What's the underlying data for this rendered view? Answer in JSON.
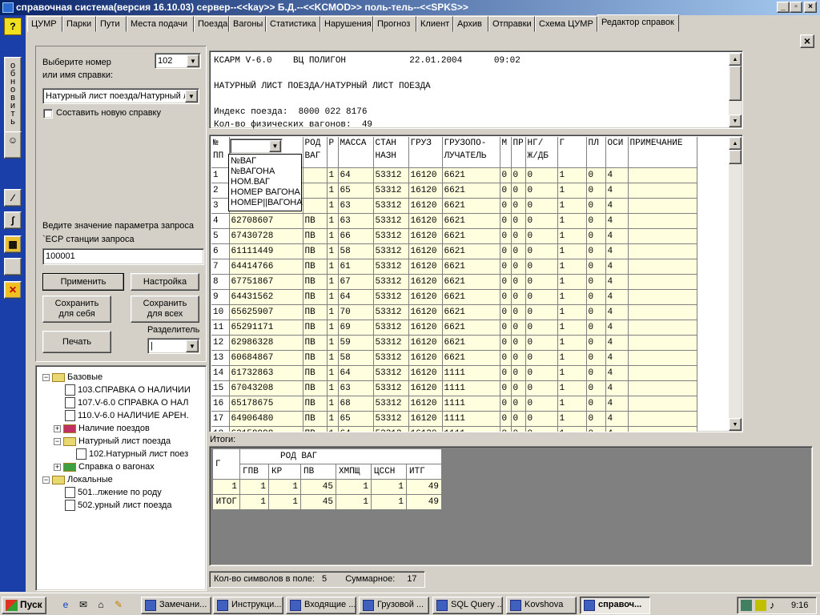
{
  "window": {
    "title": "справочная система(версия 16.10.03) сервер--<<kay>> Б.Д.--<<KCMOD>> поль-тель--<<SPKS>>",
    "min_label": "_",
    "max_label": "▫",
    "close_label": "×"
  },
  "toolbar": {
    "help_label": "?",
    "refresh_label": "обновить"
  },
  "tabs": [
    {
      "label": "ЦУМР"
    },
    {
      "label": "Парки"
    },
    {
      "label": "Пути"
    },
    {
      "label": "Места подачи"
    },
    {
      "label": "Поезда"
    },
    {
      "label": "Вагоны"
    },
    {
      "label": "Статистика"
    },
    {
      "label": "Нарушения"
    },
    {
      "label": "Прогноз"
    },
    {
      "label": "Клиент"
    },
    {
      "label": "Архив"
    },
    {
      "label": "Отправки"
    },
    {
      "label": "Схема ЦУМР"
    },
    {
      "label": "Редактор справок",
      "active": true
    }
  ],
  "close_panel_label": "×",
  "left": {
    "select_label_1": "Выберите номер",
    "select_label_2": "или имя справки:",
    "number_value": "102",
    "name_value": "Натурный лист поезда/Натурный л",
    "new_report_label": "Составить новую справку",
    "param_label": "Ведите значение параметра запроса",
    "param_name": "`ЕСР станции запроса",
    "param_value": "100001",
    "apply_label": "Применить",
    "settings_label": "Настройка",
    "save_self_1": "Сохранить",
    "save_self_2": "для себя",
    "save_all_1": "Сохранить",
    "save_all_2": "для всех",
    "separator_label": "Разделитель",
    "separator_value": "|",
    "print_label": "Печать"
  },
  "tree": [
    {
      "label": "Базовые",
      "type": "folder",
      "exp": "−",
      "level": 0
    },
    {
      "label": "103.СПРАВКА О НАЛИЧИИ",
      "type": "doc",
      "level": 2
    },
    {
      "label": "107.V-6.0  СПРАВКА О НАЛ",
      "type": "doc",
      "level": 2
    },
    {
      "label": "110.V-6.0  НАЛИЧИЕ АРЕН.",
      "type": "doc",
      "level": 2
    },
    {
      "label": "Наличие поездов",
      "type": "folder-color",
      "exp": "+",
      "level": 1
    },
    {
      "label": "Натурный лист поезда",
      "type": "folder",
      "exp": "−",
      "level": 1
    },
    {
      "label": "102.Натурный лист поез",
      "type": "doc",
      "level": 3
    },
    {
      "label": "Справка о вагонах",
      "type": "folder-green",
      "exp": "+",
      "level": 1
    },
    {
      "label": "Локальные",
      "type": "folder",
      "exp": "−",
      "level": 0
    },
    {
      "label": "501..лжение по роду",
      "type": "doc",
      "level": 2
    },
    {
      "label": "502.урный лист поезда",
      "type": "doc",
      "level": 2
    }
  ],
  "header_text": "КСАРМ V-6.0    ВЦ ПОЛИГОН            22.01.2004      09:02\n\nНАТУРНЫЙ ЛИСТ ПОЕЗДА/НАТУРНЫЙ ЛИСТ ПОЕЗДА\n\nИндекс поезда:  8000 022 8176\nКол-во физических вагонов:  49",
  "grid": {
    "headers": [
      "№\nПП",
      "",
      "РОД\nВАГ",
      "Р",
      "МАССА",
      "СТАН\nНАЗН",
      "ГРУЗ",
      "ГРУЗОПО-\nЛУЧАТЕЛЬ",
      "М",
      "ПР",
      "НГ/\nЖ/ДБ",
      "Г",
      "ПЛ",
      "ОСИ",
      "ПРИМЕЧАНИЕ"
    ],
    "rows": [
      [
        "1",
        "",
        "",
        "1",
        "64",
        "53312",
        "16120",
        "6621",
        "0",
        "0",
        "0",
        "1",
        "0",
        "4",
        ""
      ],
      [
        "2",
        "",
        "",
        "1",
        "65",
        "53312",
        "16120",
        "6621",
        "0",
        "0",
        "0",
        "1",
        "0",
        "4",
        ""
      ],
      [
        "3",
        "",
        "",
        "1",
        "63",
        "53312",
        "16120",
        "6621",
        "0",
        "0",
        "0",
        "1",
        "0",
        "4",
        ""
      ],
      [
        "4",
        "62708607",
        "ПВ",
        "1",
        "63",
        "53312",
        "16120",
        "6621",
        "0",
        "0",
        "0",
        "1",
        "0",
        "4",
        ""
      ],
      [
        "5",
        "67430728",
        "ПВ",
        "1",
        "66",
        "53312",
        "16120",
        "6621",
        "0",
        "0",
        "0",
        "1",
        "0",
        "4",
        ""
      ],
      [
        "6",
        "61111449",
        "ПВ",
        "1",
        "58",
        "53312",
        "16120",
        "6621",
        "0",
        "0",
        "0",
        "1",
        "0",
        "4",
        ""
      ],
      [
        "7",
        "64414766",
        "ПВ",
        "1",
        "61",
        "53312",
        "16120",
        "6621",
        "0",
        "0",
        "0",
        "1",
        "0",
        "4",
        ""
      ],
      [
        "8",
        "67751867",
        "ПВ",
        "1",
        "67",
        "53312",
        "16120",
        "6621",
        "0",
        "0",
        "0",
        "1",
        "0",
        "4",
        ""
      ],
      [
        "9",
        "64431562",
        "ПВ",
        "1",
        "64",
        "53312",
        "16120",
        "6621",
        "0",
        "0",
        "0",
        "1",
        "0",
        "4",
        ""
      ],
      [
        "10",
        "65625907",
        "ПВ",
        "1",
        "70",
        "53312",
        "16120",
        "6621",
        "0",
        "0",
        "0",
        "1",
        "0",
        "4",
        ""
      ],
      [
        "11",
        "65291171",
        "ПВ",
        "1",
        "69",
        "53312",
        "16120",
        "6621",
        "0",
        "0",
        "0",
        "1",
        "0",
        "4",
        ""
      ],
      [
        "12",
        "62986328",
        "ПВ",
        "1",
        "59",
        "53312",
        "16120",
        "6621",
        "0",
        "0",
        "0",
        "1",
        "0",
        "4",
        ""
      ],
      [
        "13",
        "60684867",
        "ПВ",
        "1",
        "58",
        "53312",
        "16120",
        "6621",
        "0",
        "0",
        "0",
        "1",
        "0",
        "4",
        ""
      ],
      [
        "14",
        "61732863",
        "ПВ",
        "1",
        "64",
        "53312",
        "16120",
        "1111",
        "0",
        "0",
        "0",
        "1",
        "0",
        "4",
        ""
      ],
      [
        "15",
        "67043208",
        "ПВ",
        "1",
        "63",
        "53312",
        "16120",
        "1111",
        "0",
        "0",
        "0",
        "1",
        "0",
        "4",
        ""
      ],
      [
        "16",
        "65178675",
        "ПВ",
        "1",
        "68",
        "53312",
        "16120",
        "1111",
        "0",
        "0",
        "0",
        "1",
        "0",
        "4",
        ""
      ],
      [
        "17",
        "64906480",
        "ПВ",
        "1",
        "65",
        "53312",
        "16120",
        "1111",
        "0",
        "0",
        "0",
        "1",
        "0",
        "4",
        ""
      ],
      [
        "18",
        "63158998",
        "ПВ",
        "1",
        "64",
        "53312",
        "16120",
        "1111",
        "0",
        "0",
        "0",
        "1",
        "0",
        "4",
        ""
      ]
    ]
  },
  "dropdown": {
    "items": [
      "№ВАГ",
      "№ВАГОНА",
      "НОМ.ВАГ",
      "НОМЕР ВАГОНА",
      "НОМЕР||ВАГОНА"
    ]
  },
  "itogi_label": "Итоги:",
  "summary": {
    "row_header": "Г",
    "group_header": "РОД ВАГ",
    "columns": [
      "ГПВ",
      "КР",
      "ПВ",
      "ХМПЩ",
      "ЦССН",
      "ИТГ"
    ],
    "rows": [
      {
        "label": "1",
        "values": [
          "1",
          "1",
          "45",
          "1",
          "1",
          "49"
        ]
      },
      {
        "label": "ИТОГ",
        "values": [
          "1",
          "1",
          "45",
          "1",
          "1",
          "49"
        ]
      }
    ]
  },
  "status": {
    "chars_label": "Кол-во символов в поле:",
    "chars_value": "5",
    "total_label": "Суммарное:",
    "total_value": "17"
  },
  "taskbar": {
    "start_label": "Пуск",
    "tasks": [
      {
        "label": "Замечани..."
      },
      {
        "label": "Инструкци..."
      },
      {
        "label": "Входящие ..."
      },
      {
        "label": "Грузовой ..."
      },
      {
        "label": "SQL Query ..."
      },
      {
        "label": "Kovshova"
      },
      {
        "label": "справоч...",
        "active": true
      }
    ],
    "clock": "9:16"
  }
}
